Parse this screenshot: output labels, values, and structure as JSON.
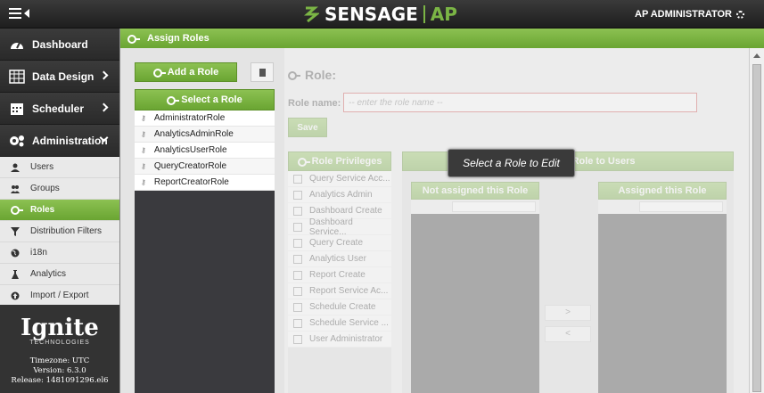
{
  "header": {
    "brand": "SENSAGE",
    "product": "AP",
    "user": "AP ADMINISTRATOR",
    "brand_color": "#7bb545"
  },
  "sidebar": {
    "main_items": [
      {
        "label": "Dashboard",
        "icon": "dashboard-icon"
      },
      {
        "label": "Data Design",
        "icon": "table-icon"
      },
      {
        "label": "Scheduler",
        "icon": "calendar-icon"
      },
      {
        "label": "Administration",
        "icon": "gears-icon"
      }
    ],
    "sub_items": [
      {
        "label": "Users",
        "icon": "user-icon"
      },
      {
        "label": "Groups",
        "icon": "group-icon"
      },
      {
        "label": "Roles",
        "icon": "key-icon",
        "active": true
      },
      {
        "label": "Distribution Filters",
        "icon": "filter-icon"
      },
      {
        "label": "i18n",
        "icon": "globe-icon"
      },
      {
        "label": "Analytics",
        "icon": "flask-icon"
      },
      {
        "label": "Import / Export",
        "icon": "import-export-icon"
      }
    ],
    "footer": {
      "logo": "Ignite",
      "logo_sub": "TECHNOLOGIES",
      "timezone": "Timezone: UTC",
      "version": "Version: 6.3.0",
      "release": "Release: 1481091296.el6"
    }
  },
  "page": {
    "title": "Assign Roles",
    "add_role": "Add a Role",
    "select_role": "Select a Role",
    "roles": [
      "AdministratorRole",
      "AnalyticsAdminRole",
      "AnalyticsUserRole",
      "QueryCreatorRole",
      "ReportCreatorRole"
    ],
    "editor": {
      "heading": "Role:",
      "role_name_label": "Role name:",
      "role_name_placeholder": "-- enter the role name --",
      "save": "Save",
      "privileges_title": "Role Privileges",
      "privileges": [
        "Query Service Acc...",
        "Analytics Admin",
        "Dashboard Create",
        "Dashboard Service...",
        "Query Create",
        "Analytics User",
        "Report Create",
        "Report Service Ac...",
        "Schedule Create",
        "Schedule Service ...",
        "User Administrator"
      ],
      "assign_title": "Assign this Role to Users",
      "not_assigned": "Not assigned this Role",
      "assigned": "Assigned this Role",
      "move_right": ">",
      "move_left": "<"
    },
    "tooltip": "Select a Role to Edit"
  }
}
